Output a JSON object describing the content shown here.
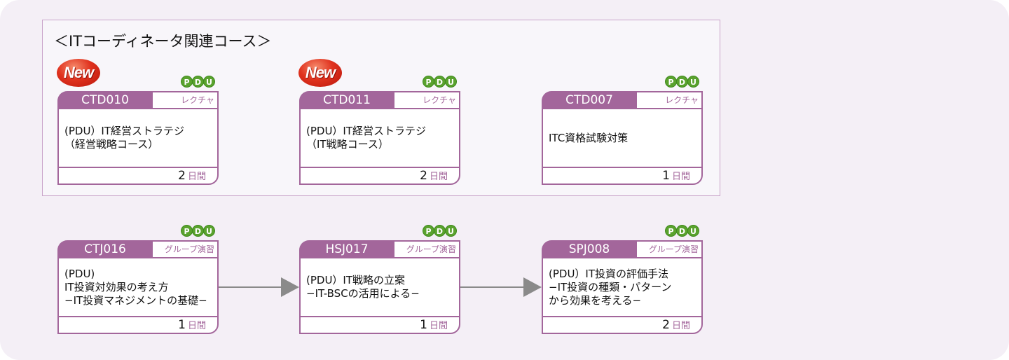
{
  "group": {
    "title": "＜ITコーディネータ関連コース＞"
  },
  "badges": {
    "new_label": "New",
    "pdu_letters": [
      "P",
      "D",
      "U"
    ]
  },
  "courses": [
    {
      "code": "CTD010",
      "type": "レクチャ",
      "title": "(PDU）IT経営ストラテジ\n（経営戦略コース）",
      "days": "2",
      "unit": "日間",
      "new": true,
      "pdu": true
    },
    {
      "code": "CTD011",
      "type": "レクチャ",
      "title": "(PDU）IT経営ストラテジ\n（IT戦略コース）",
      "days": "2",
      "unit": "日間",
      "new": true,
      "pdu": true
    },
    {
      "code": "CTD007",
      "type": "レクチャ",
      "title": "ITC資格試験対策",
      "days": "1",
      "unit": "日間",
      "new": false,
      "pdu": true
    },
    {
      "code": "CTJ016",
      "type": "グループ演習",
      "title": "(PDU)\nIT投資対効果の考え方\n−IT投資マネジメントの基礎−",
      "days": "1",
      "unit": "日間",
      "new": false,
      "pdu": true
    },
    {
      "code": "HSJ017",
      "type": "グループ演習",
      "title": "(PDU）IT戦略の立案\n−IT-BSCの活用による−",
      "days": "1",
      "unit": "日間",
      "new": false,
      "pdu": true
    },
    {
      "code": "SPJ008",
      "type": "グループ演習",
      "title": "(PDU）IT投資の評価手法\n−IT投資の種類・パターン\nから効果を考える−",
      "days": "2",
      "unit": "日間",
      "new": false,
      "pdu": true
    }
  ],
  "flow": [
    {
      "from": "CTJ016",
      "to": "HSJ017"
    },
    {
      "from": "HSJ017",
      "to": "SPJ008"
    }
  ]
}
